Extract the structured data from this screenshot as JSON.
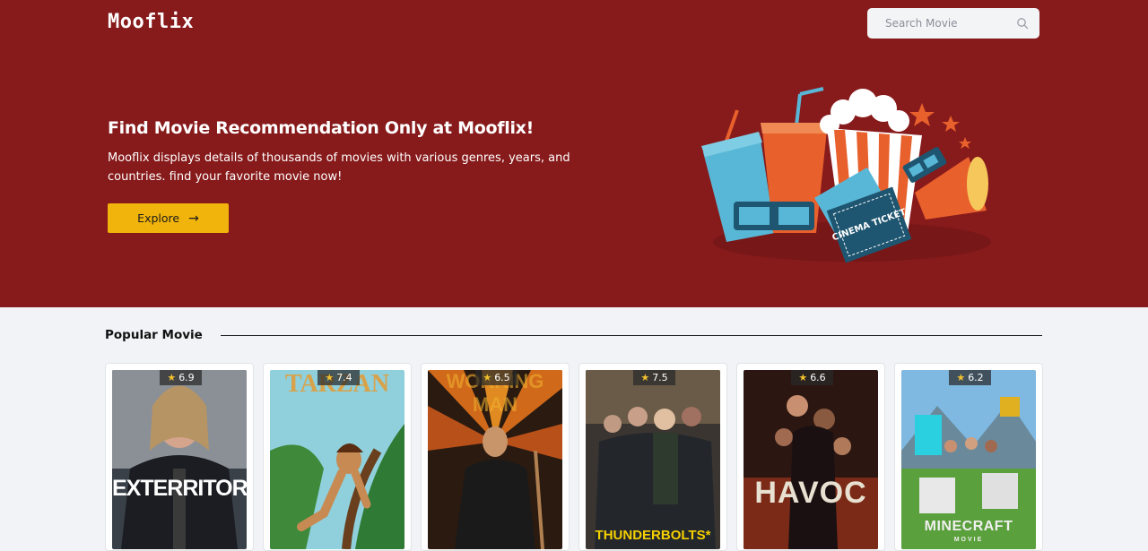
{
  "header": {
    "logo": "Mooflix",
    "search_placeholder": "Search Movie"
  },
  "hero": {
    "title": "Find Movie Recommendation Only at Mooflix!",
    "description": "Mooflix displays details of thousands of movies with various genres, years, and countries. find your favorite movie now!",
    "explore_label": "Explore",
    "explore_arrow": "→",
    "ticket_text": "CINEMA TICKET"
  },
  "popular": {
    "title": "Popular Movie",
    "movies": [
      {
        "rating": "6.9",
        "poster_text": "EXTERRITORIAL"
      },
      {
        "rating": "7.4",
        "poster_text": "TARZAN"
      },
      {
        "rating": "6.5",
        "poster_text": "WORKING MAN"
      },
      {
        "rating": "7.5",
        "poster_text": "THUNDERBOLTS*"
      },
      {
        "rating": "6.6",
        "poster_text": "HAVOC"
      },
      {
        "rating": "6.2",
        "poster_text": "MINECRAFT",
        "poster_subtext": "MOVIE"
      }
    ]
  },
  "colors": {
    "hero_bg": "#871a1b",
    "accent": "#f1b40c",
    "page_bg": "#f1f3f6",
    "star": "#f2c12e"
  },
  "icons": {
    "search": "search-icon",
    "star": "star-icon",
    "arrow": "arrow-right-icon"
  }
}
